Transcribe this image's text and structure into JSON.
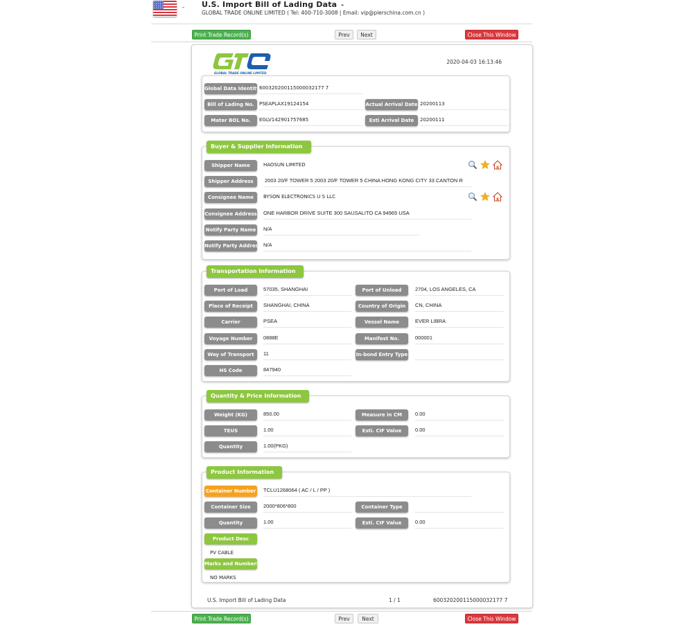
{
  "header": {
    "title": "U.S. Import Bill of Lading Data",
    "title_caret": "-",
    "flag_caret": "-",
    "subtitle": "GLOBAL TRADE ONLINE LIMITED ( Tel: 400-710-3008 | Email: vip@pierschina.com.cn )"
  },
  "toolbar": {
    "print_label": "Print Trade Record(s)",
    "prev_label": "Prev",
    "next_label": "Next",
    "close_label": "Close This Window"
  },
  "document": {
    "logo_text": "GTC",
    "logo_subtext": "GLOBAL TRADE ONLINE LIMITED",
    "timestamp": "2020-04-03 16:13:46",
    "identity": {
      "global_data_identity_label": "Global Data Identity",
      "global_data_identity": "600320200115000032177 7",
      "bill_of_lading_label": "Bill of Lading No.",
      "bill_of_lading": "PSEAPLAX19124154",
      "actual_arrival_label": "Actual Arrival Date",
      "actual_arrival": "20200113",
      "master_bol_label": "Mater BOL No.",
      "master_bol": "EGLV142901757685",
      "esti_arrival_label": "Esti Arrival Date",
      "esti_arrival": "20200111"
    },
    "buyer_supplier": {
      "title": "Buyer & Supplier Information",
      "shipper_name_label": "Shipper Name",
      "shipper_name": "HAOSUN LIMITED",
      "shipper_address_label": "Shipper Address",
      "shipper_address": "2003 20/F TOWER 5 2003 20/F TOWER 5 CHINA HONG KONG CITY 33 CANTON R",
      "consignee_name_label": "Consignee Name",
      "consignee_name": "BYSON ELECTRONICS U S LLC",
      "consignee_address_label": "Consignee Address",
      "consignee_address": "ONE HARBOR DRIVE SUITE 300 SAUSALITO CA 94965 USA",
      "notify_name_label": "Notify Party Name",
      "notify_name": "N/A",
      "notify_address_label": "Notify Party Address",
      "notify_address": "N/A"
    },
    "transportation": {
      "title": "Transportation Information",
      "port_of_load_label": "Port of Load",
      "port_of_load": "57035, SHANGHAI",
      "port_of_unload_label": "Port of Unload",
      "port_of_unload": "2704, LOS ANGELES, CA",
      "place_of_receipt_label": "Place of Receipt",
      "place_of_receipt": "SHANGHAI, CHINA",
      "country_of_origin_label": "Country of Origin",
      "country_of_origin": "CN, CHINA",
      "carrier_label": "Carrier",
      "carrier": "PSEA",
      "vessel_name_label": "Vessel Name",
      "vessel_name": "EVER LIBRA",
      "voyage_number_label": "Voyage Number",
      "voyage_number": "0888E",
      "manifest_no_label": "Manifest No.",
      "manifest_no": "000001",
      "way_of_transport_label": "Way of Transport",
      "way_of_transport": "11",
      "inbond_entry_label": "In-bond Entry Type",
      "inbond_entry": "",
      "hs_code_label": "HS Code",
      "hs_code": "847940"
    },
    "quantity_price": {
      "title": "Quantity & Price Information",
      "weight_label": "Weight (KG)",
      "weight": "850.00",
      "measure_label": "Measure in CM",
      "measure": "0.00",
      "teus_label": "TEUS",
      "teus": "1.00",
      "cif_label": "Esti. CIF Value",
      "cif": "0.00",
      "quantity_label": "Quantity",
      "quantity": "1.00(PKG)"
    },
    "product": {
      "title": "Product Information",
      "container_number_label": "Container Number",
      "container_number": "TCLU1268064 ( AC / L / PP )",
      "container_size_label": "Container Size",
      "container_size": "2000*806*800",
      "container_type_label": "Container Type",
      "container_type": "",
      "quantity_label": "Quantity",
      "quantity": "1.00",
      "cif_label": "Esti. CIF Value",
      "cif": "0.00",
      "product_desc_label": "Product Desc",
      "product_desc": "PV CABLE",
      "marks_label": "Marks and Numbers",
      "marks": "NO MARKS"
    },
    "footer": {
      "left": "U.S. Import Bill of Lading Data",
      "page": "1 / 1",
      "id": "600320200115000032177 7"
    }
  },
  "icons": {
    "search": "magnifier-icon",
    "favorite": "star-icon",
    "company": "home-icon"
  },
  "colors": {
    "green_button": "#4cb04f",
    "red_button": "#d9393d",
    "section_green": "#8dc63f",
    "label_grey": "#8c8c8c",
    "label_orange": "#f7a21b"
  }
}
